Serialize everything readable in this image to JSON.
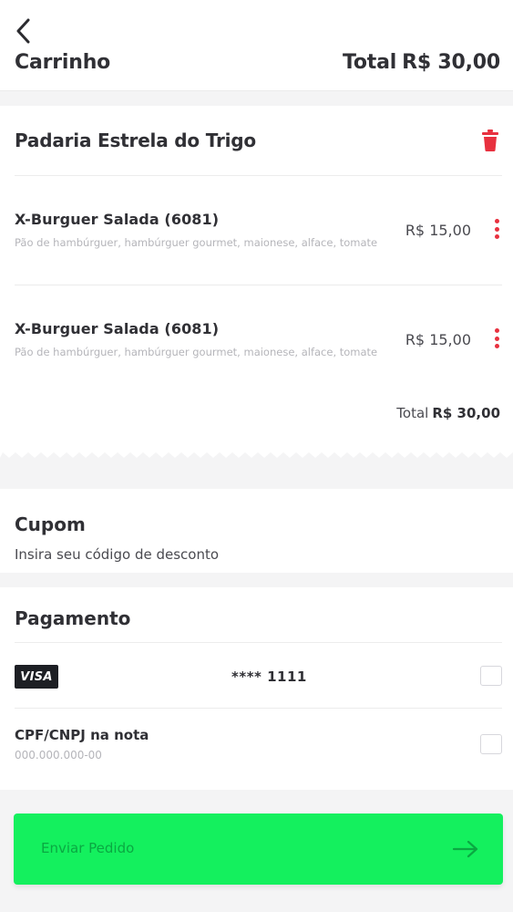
{
  "header": {
    "title": "Carrinho",
    "total_label": "Total",
    "total_value": "R$ 30,00"
  },
  "store": {
    "name": "Padaria Estrela do Trigo"
  },
  "items": [
    {
      "name": "X-Burguer Salada (6081)",
      "description": "Pão de hambúrguer, hambúrguer gourmet, maionese, alface, tomate",
      "price": "R$ 15,00"
    },
    {
      "name": "X-Burguer Salada (6081)",
      "description": "Pão de hambúrguer, hambúrguer gourmet, maionese, alface, tomate",
      "price": "R$ 15,00"
    }
  ],
  "cart_total": {
    "label": "Total",
    "value": "R$ 30,00"
  },
  "coupon": {
    "title": "Cupom",
    "subtitle": "Insira seu código de desconto"
  },
  "payment": {
    "title": "Pagamento",
    "card_brand": "VISA",
    "card_number": "**** 1111",
    "cpf_label": "CPF/CNPJ na nota",
    "cpf_placeholder": "000.000.000-00"
  },
  "submit": {
    "label": "Enviar Pedido"
  },
  "colors": {
    "accent_red": "#e8313f",
    "button_green": "#14f05e",
    "button_text": "#0aa842"
  },
  "icons": {
    "back": "chevron-left-icon",
    "delete": "trash-icon",
    "options": "more-vertical-icon",
    "card": "visa-logo",
    "submit": "arrow-right-icon"
  }
}
